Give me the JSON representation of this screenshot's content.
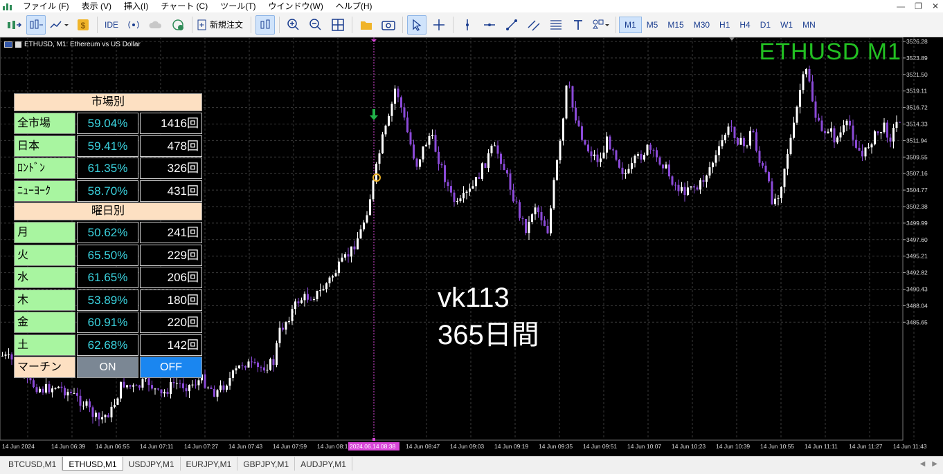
{
  "menu": {
    "items": [
      "ファイル (F)",
      "表示 (V)",
      "挿入(I)",
      "チャート (C)",
      "ツール(T)",
      "ウインドウ(W)",
      "ヘルプ(H)"
    ],
    "window_controls": [
      "—",
      "❐",
      "✕"
    ]
  },
  "toolbar": {
    "ide_label": "IDE",
    "new_order_label": "新規注文",
    "timeframes": [
      "M1",
      "M5",
      "M15",
      "M30",
      "H1",
      "H4",
      "D1",
      "W1",
      "MN"
    ],
    "active_timeframe": "M1"
  },
  "chart": {
    "header": "ETHUSD, M1:  Ethereum vs US Dollar",
    "symbol_big": "ETHUSD M1",
    "label_vk": "vk113",
    "label_days": "365日間",
    "price_levels": [
      "3526.28",
      "3523.89",
      "3521.50",
      "3519.11",
      "3516.72",
      "3514.33",
      "3511.94",
      "3509.55",
      "3507.16",
      "3504.77",
      "3502.38",
      "3499.99",
      "3497.60",
      "3495.21",
      "3492.82",
      "3490.43",
      "3488.04",
      "3485.65"
    ],
    "time_labels": [
      "14 Jun 2024",
      "14 Jun 06:39",
      "14 Jun 06:55",
      "14 Jun 07:11",
      "14 Jun 07:27",
      "14 Jun 07:43",
      "14 Jun 07:59",
      "14 Jun 08:15",
      "2024.06.14 08:38",
      "14 Jun 08:47",
      "14 Jun 09:03",
      "14 Jun 09:19",
      "14 Jun 09:35",
      "14 Jun 09:51",
      "14 Jun 10:07",
      "14 Jun 10:23",
      "14 Jun 10:39",
      "14 Jun 10:55",
      "14 Jun 11:11",
      "14 Jun 11:27",
      "14 Jun 11:43"
    ],
    "colors": {
      "up": "#ffffff",
      "down": "#8b4ad8",
      "grid": "#3a3a3a",
      "highlight": "#d946d9",
      "symbol": "#22c022"
    }
  },
  "stats": {
    "market_header": "市場別",
    "markets": [
      {
        "name": "全市場",
        "pct": "59.04%",
        "count": "1416回"
      },
      {
        "name": "日本",
        "pct": "59.41%",
        "count": "478回"
      },
      {
        "name": "ﾛﾝﾄﾞﾝ",
        "pct": "61.35%",
        "count": "326回"
      },
      {
        "name": "ﾆｭｰﾖｰｸ",
        "pct": "58.70%",
        "count": "431回"
      }
    ],
    "weekday_header": "曜日別",
    "weekdays": [
      {
        "name": "月",
        "pct": "50.62%",
        "count": "241回"
      },
      {
        "name": "火",
        "pct": "65.50%",
        "count": "229回"
      },
      {
        "name": "水",
        "pct": "61.65%",
        "count": "206回"
      },
      {
        "name": "木",
        "pct": "53.89%",
        "count": "180回"
      },
      {
        "name": "金",
        "pct": "60.91%",
        "count": "220回"
      },
      {
        "name": "土",
        "pct": "62.68%",
        "count": "142回"
      }
    ],
    "martingale_label": "マーチン",
    "on_label": "ON",
    "off_label": "OFF"
  },
  "tabs": {
    "items": [
      "BTCUSD,M1",
      "ETHUSD,M1",
      "USDJPY,M1",
      "EURJPY,M1",
      "GBPJPY,M1",
      "AUDJPY,M1"
    ],
    "active": "ETHUSD,M1"
  }
}
